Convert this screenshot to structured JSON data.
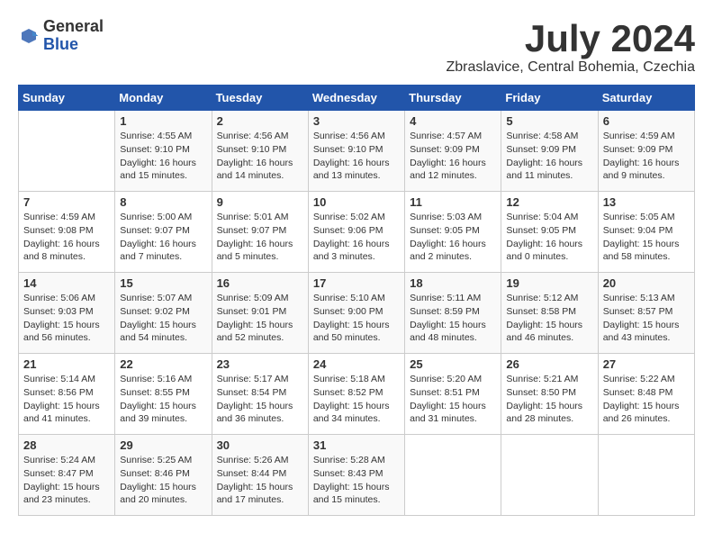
{
  "logo": {
    "general": "General",
    "blue": "Blue"
  },
  "header": {
    "month": "July 2024",
    "location": "Zbraslavice, Central Bohemia, Czechia"
  },
  "weekdays": [
    "Sunday",
    "Monday",
    "Tuesday",
    "Wednesday",
    "Thursday",
    "Friday",
    "Saturday"
  ],
  "weeks": [
    [
      {
        "day": "",
        "info": ""
      },
      {
        "day": "1",
        "info": "Sunrise: 4:55 AM\nSunset: 9:10 PM\nDaylight: 16 hours\nand 15 minutes."
      },
      {
        "day": "2",
        "info": "Sunrise: 4:56 AM\nSunset: 9:10 PM\nDaylight: 16 hours\nand 14 minutes."
      },
      {
        "day": "3",
        "info": "Sunrise: 4:56 AM\nSunset: 9:10 PM\nDaylight: 16 hours\nand 13 minutes."
      },
      {
        "day": "4",
        "info": "Sunrise: 4:57 AM\nSunset: 9:09 PM\nDaylight: 16 hours\nand 12 minutes."
      },
      {
        "day": "5",
        "info": "Sunrise: 4:58 AM\nSunset: 9:09 PM\nDaylight: 16 hours\nand 11 minutes."
      },
      {
        "day": "6",
        "info": "Sunrise: 4:59 AM\nSunset: 9:09 PM\nDaylight: 16 hours\nand 9 minutes."
      }
    ],
    [
      {
        "day": "7",
        "info": "Sunrise: 4:59 AM\nSunset: 9:08 PM\nDaylight: 16 hours\nand 8 minutes."
      },
      {
        "day": "8",
        "info": "Sunrise: 5:00 AM\nSunset: 9:07 PM\nDaylight: 16 hours\nand 7 minutes."
      },
      {
        "day": "9",
        "info": "Sunrise: 5:01 AM\nSunset: 9:07 PM\nDaylight: 16 hours\nand 5 minutes."
      },
      {
        "day": "10",
        "info": "Sunrise: 5:02 AM\nSunset: 9:06 PM\nDaylight: 16 hours\nand 3 minutes."
      },
      {
        "day": "11",
        "info": "Sunrise: 5:03 AM\nSunset: 9:05 PM\nDaylight: 16 hours\nand 2 minutes."
      },
      {
        "day": "12",
        "info": "Sunrise: 5:04 AM\nSunset: 9:05 PM\nDaylight: 16 hours\nand 0 minutes."
      },
      {
        "day": "13",
        "info": "Sunrise: 5:05 AM\nSunset: 9:04 PM\nDaylight: 15 hours\nand 58 minutes."
      }
    ],
    [
      {
        "day": "14",
        "info": "Sunrise: 5:06 AM\nSunset: 9:03 PM\nDaylight: 15 hours\nand 56 minutes."
      },
      {
        "day": "15",
        "info": "Sunrise: 5:07 AM\nSunset: 9:02 PM\nDaylight: 15 hours\nand 54 minutes."
      },
      {
        "day": "16",
        "info": "Sunrise: 5:09 AM\nSunset: 9:01 PM\nDaylight: 15 hours\nand 52 minutes."
      },
      {
        "day": "17",
        "info": "Sunrise: 5:10 AM\nSunset: 9:00 PM\nDaylight: 15 hours\nand 50 minutes."
      },
      {
        "day": "18",
        "info": "Sunrise: 5:11 AM\nSunset: 8:59 PM\nDaylight: 15 hours\nand 48 minutes."
      },
      {
        "day": "19",
        "info": "Sunrise: 5:12 AM\nSunset: 8:58 PM\nDaylight: 15 hours\nand 46 minutes."
      },
      {
        "day": "20",
        "info": "Sunrise: 5:13 AM\nSunset: 8:57 PM\nDaylight: 15 hours\nand 43 minutes."
      }
    ],
    [
      {
        "day": "21",
        "info": "Sunrise: 5:14 AM\nSunset: 8:56 PM\nDaylight: 15 hours\nand 41 minutes."
      },
      {
        "day": "22",
        "info": "Sunrise: 5:16 AM\nSunset: 8:55 PM\nDaylight: 15 hours\nand 39 minutes."
      },
      {
        "day": "23",
        "info": "Sunrise: 5:17 AM\nSunset: 8:54 PM\nDaylight: 15 hours\nand 36 minutes."
      },
      {
        "day": "24",
        "info": "Sunrise: 5:18 AM\nSunset: 8:52 PM\nDaylight: 15 hours\nand 34 minutes."
      },
      {
        "day": "25",
        "info": "Sunrise: 5:20 AM\nSunset: 8:51 PM\nDaylight: 15 hours\nand 31 minutes."
      },
      {
        "day": "26",
        "info": "Sunrise: 5:21 AM\nSunset: 8:50 PM\nDaylight: 15 hours\nand 28 minutes."
      },
      {
        "day": "27",
        "info": "Sunrise: 5:22 AM\nSunset: 8:48 PM\nDaylight: 15 hours\nand 26 minutes."
      }
    ],
    [
      {
        "day": "28",
        "info": "Sunrise: 5:24 AM\nSunset: 8:47 PM\nDaylight: 15 hours\nand 23 minutes."
      },
      {
        "day": "29",
        "info": "Sunrise: 5:25 AM\nSunset: 8:46 PM\nDaylight: 15 hours\nand 20 minutes."
      },
      {
        "day": "30",
        "info": "Sunrise: 5:26 AM\nSunset: 8:44 PM\nDaylight: 15 hours\nand 17 minutes."
      },
      {
        "day": "31",
        "info": "Sunrise: 5:28 AM\nSunset: 8:43 PM\nDaylight: 15 hours\nand 15 minutes."
      },
      {
        "day": "",
        "info": ""
      },
      {
        "day": "",
        "info": ""
      },
      {
        "day": "",
        "info": ""
      }
    ]
  ]
}
